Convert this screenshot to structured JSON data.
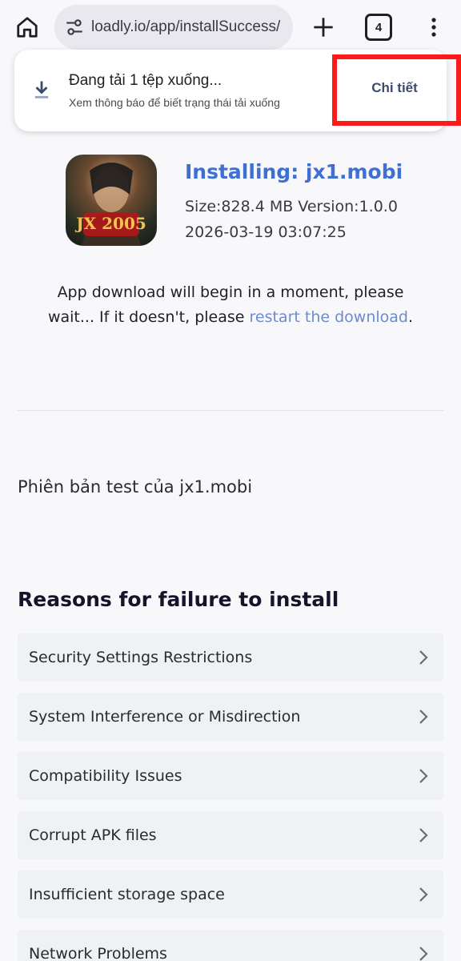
{
  "browser": {
    "url": "loadly.io/app/installSuccess/",
    "tab_count": "4",
    "icons": {
      "home": "home-icon",
      "site_settings": "tune-icon",
      "new_tab": "plus-icon",
      "tabs": "tab-switcher-icon",
      "menu": "more-vert-icon"
    }
  },
  "download_toast": {
    "title": "Đang tải 1 tệp xuống...",
    "subtitle": "Xem thông báo để biết trạng thái tải xuống",
    "action_label": "Chi tiết",
    "icon": "download-icon",
    "highlight_color": "#ff1a1a"
  },
  "app": {
    "title": "Installing: jx1.mobi",
    "meta": "Size:828.4 MB Version:1.0.0",
    "date": "2026-03-19 03:07:25",
    "icon_caption": "JX 2005",
    "title_color": "#3f6fd1"
  },
  "notice": {
    "text_before": "App download will begin in a moment, please wait... If it doesn't, please ",
    "link_text": "restart the download",
    "text_after": ".",
    "link_color": "#6c8bd1"
  },
  "test_version_text": "Phiên bản test của jx1.mobi",
  "failure_section": {
    "title": "Reasons for failure to install",
    "items": [
      {
        "label": "Security Settings Restrictions"
      },
      {
        "label": "System Interference or Misdirection"
      },
      {
        "label": "Compatibility Issues"
      },
      {
        "label": "Corrupt APK files"
      },
      {
        "label": "Insufficient storage space"
      },
      {
        "label": "Network Problems"
      }
    ],
    "chevron_icon": "chevron-right-icon"
  }
}
